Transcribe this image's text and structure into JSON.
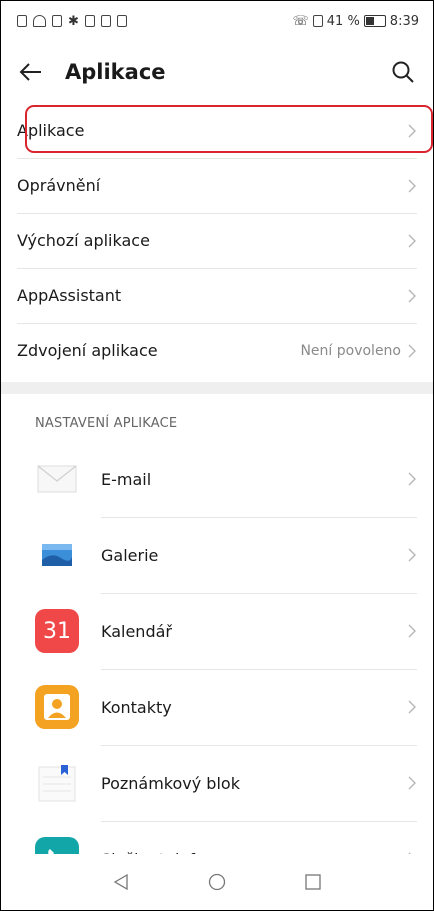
{
  "status_bar": {
    "time": "8:39",
    "battery_text": "41 %",
    "battery_level": 0.41
  },
  "header": {
    "title": "Aplikace",
    "back_icon": "arrow-left-icon",
    "search_icon": "search-icon"
  },
  "menu": {
    "items": [
      {
        "label": "Aplikace",
        "value": ""
      },
      {
        "label": "Oprávnění",
        "value": ""
      },
      {
        "label": "Výchozí aplikace",
        "value": ""
      },
      {
        "label": "AppAssistant",
        "value": ""
      },
      {
        "label": "Zdvojení aplikace",
        "value": "Není povoleno"
      }
    ]
  },
  "app_settings": {
    "section_title": "NASTAVENÍ APLIKACE",
    "items": [
      {
        "label": "E-mail",
        "icon": "mail-icon"
      },
      {
        "label": "Galerie",
        "icon": "gallery-icon"
      },
      {
        "label": "Kalendář",
        "icon": "calendar-icon",
        "icon_text": "31"
      },
      {
        "label": "Kontakty",
        "icon": "contacts-icon"
      },
      {
        "label": "Poznámkový blok",
        "icon": "notepad-icon"
      },
      {
        "label": "Služby telefonu",
        "icon": "phone-icon"
      }
    ]
  },
  "colors": {
    "highlight": "#d9252e",
    "calendar": "#f04848",
    "contacts": "#f3a222",
    "phone": "#13a6a8"
  }
}
